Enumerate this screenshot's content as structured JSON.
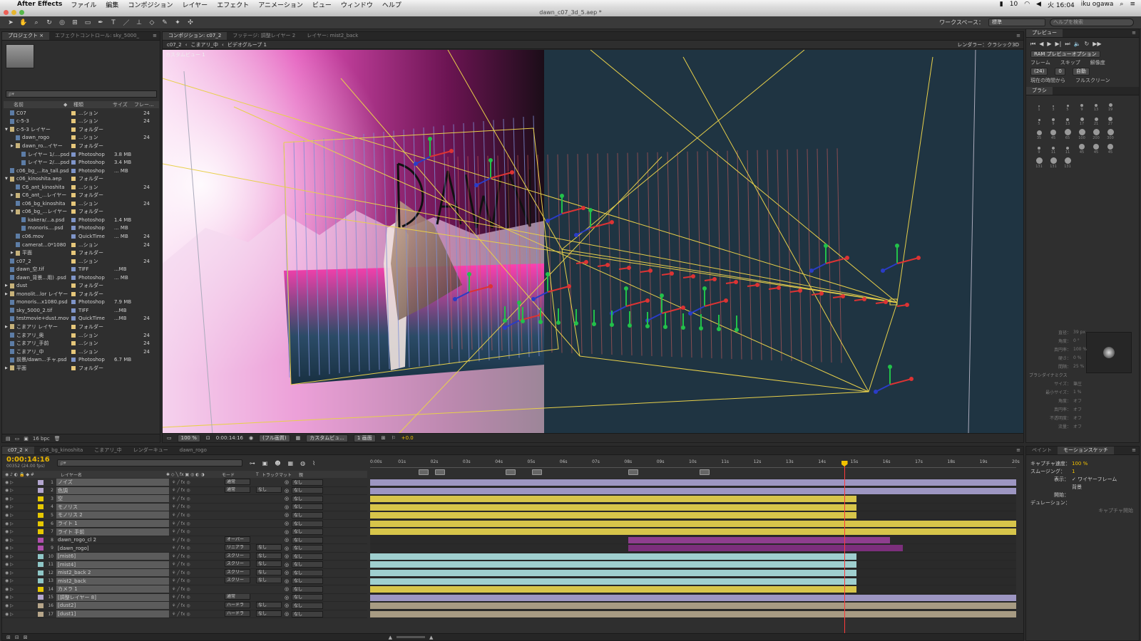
{
  "menubar": {
    "app_name": "After Effects",
    "items": [
      "ファイル",
      "編集",
      "コンポジション",
      "レイヤー",
      "エフェクト",
      "アニメーション",
      "ビュー",
      "ウィンドウ",
      "ヘルプ"
    ],
    "status": {
      "battery": "10",
      "clock": "火 16:04",
      "user": "iku ogawa"
    }
  },
  "window": {
    "title": "dawn_c07_3d_5.aep *"
  },
  "toolbar": {
    "workspace_label": "ワークスペース：",
    "workspace_value": "標準",
    "help_search_placeholder": "ヘルプを検索"
  },
  "project": {
    "tabs": [
      "プロジェクト ×",
      "エフェクトコントロール: sky_5000_"
    ],
    "search_placeholder": "ρ▾",
    "columns": {
      "name": "名前",
      "type": "種類",
      "size": "サイズ",
      "frames": "フレー..."
    },
    "items": [
      {
        "name": "C07",
        "type": "...ション",
        "size": "",
        "fr": "24",
        "label": "#e6c77a",
        "indent": 0,
        "twirl": ""
      },
      {
        "name": "c-5-3",
        "type": "...ション",
        "size": "",
        "fr": "24",
        "label": "#e6c77a",
        "indent": 0,
        "twirl": ""
      },
      {
        "name": "c-5-3 レイヤー",
        "type": "フォルダー",
        "size": "",
        "fr": "",
        "label": "#e6c77a",
        "indent": 0,
        "twirl": "▼"
      },
      {
        "name": "dawn_rogo",
        "type": "...ション",
        "size": "",
        "fr": "24",
        "label": "#e6c77a",
        "indent": 1,
        "twirl": ""
      },
      {
        "name": "dawn_ro...イヤー",
        "type": "フォルダー",
        "size": "",
        "fr": "",
        "label": "#e6c77a",
        "indent": 1,
        "twirl": "▶"
      },
      {
        "name": "レイヤー 1/....psd",
        "type": "Photoshop",
        "size": "3.8 MB",
        "fr": "",
        "label": "#7f95c9",
        "indent": 2,
        "twirl": ""
      },
      {
        "name": "レイヤー 2/....psd",
        "type": "Photoshop",
        "size": "3.4 MB",
        "fr": "",
        "label": "#7f95c9",
        "indent": 2,
        "twirl": ""
      },
      {
        "name": "c06_bg_...ita_tall.psd",
        "type": "Photoshop",
        "size": "... MB",
        "fr": "",
        "label": "#7f95c9",
        "indent": 0,
        "twirl": ""
      },
      {
        "name": "c06_kinoshita.aep",
        "type": "フォルダー",
        "size": "",
        "fr": "",
        "label": "#e6c77a",
        "indent": 0,
        "twirl": "▼"
      },
      {
        "name": "C6_ant_kinoshita",
        "type": "...ション",
        "size": "",
        "fr": "24",
        "label": "#e6c77a",
        "indent": 1,
        "twirl": ""
      },
      {
        "name": "C6_ant_...レイヤー",
        "type": "フォルダー",
        "size": "",
        "fr": "",
        "label": "#e6c77a",
        "indent": 1,
        "twirl": "▶"
      },
      {
        "name": "c06_bg_kinoshita",
        "type": "...ション",
        "size": "",
        "fr": "24",
        "label": "#e6c77a",
        "indent": 1,
        "twirl": ""
      },
      {
        "name": "c06_bg_...レイヤー",
        "type": "フォルダー",
        "size": "",
        "fr": "",
        "label": "#e6c77a",
        "indent": 1,
        "twirl": "▼"
      },
      {
        "name": "kakera/...a.psd",
        "type": "Photoshop",
        "size": "1.4 MB",
        "fr": "",
        "label": "#7f95c9",
        "indent": 2,
        "twirl": ""
      },
      {
        "name": "monoris....psd",
        "type": "Photoshop",
        "size": "... MB",
        "fr": "",
        "label": "#7f95c9",
        "indent": 2,
        "twirl": ""
      },
      {
        "name": "c06.mov",
        "type": "QuickTime",
        "size": "... MB",
        "fr": "24",
        "label": "#7f95c9",
        "indent": 1,
        "twirl": ""
      },
      {
        "name": "camerat...0*1080",
        "type": "...ション",
        "size": "",
        "fr": "24",
        "label": "#e6c77a",
        "indent": 1,
        "twirl": ""
      },
      {
        "name": "平面",
        "type": "フォルダー",
        "size": "",
        "fr": "",
        "label": "#e6c77a",
        "indent": 1,
        "twirl": "▶"
      },
      {
        "name": "c07_2",
        "type": "...ション",
        "size": "",
        "fr": "24",
        "label": "#e6c77a",
        "indent": 0,
        "twirl": ""
      },
      {
        "name": "dawn_空.tif",
        "type": "TIFF",
        "size": "...MB",
        "fr": "",
        "label": "#7f95c9",
        "indent": 0,
        "twirl": ""
      },
      {
        "name": "dawn_背景...用) .psd",
        "type": "Photoshop",
        "size": "... MB",
        "fr": "",
        "label": "#7f95c9",
        "indent": 0,
        "twirl": ""
      },
      {
        "name": "dust",
        "type": "フォルダー",
        "size": "",
        "fr": "",
        "label": "#e6c77a",
        "indent": 0,
        "twirl": "▶"
      },
      {
        "name": "monolit...lor レイヤー",
        "type": "フォルダー",
        "size": "",
        "fr": "",
        "label": "#e6c77a",
        "indent": 0,
        "twirl": "▶"
      },
      {
        "name": "monoris...x1080.psd",
        "type": "Photoshop",
        "size": "7.9 MB",
        "fr": "",
        "label": "#7f95c9",
        "indent": 0,
        "twirl": ""
      },
      {
        "name": "sky_5000_2.tif",
        "type": "TIFF",
        "size": "...MB",
        "fr": "",
        "label": "#7f95c9",
        "indent": 0,
        "twirl": ""
      },
      {
        "name": "testmovie+dust.mov",
        "type": "QuickTime",
        "size": "...MB",
        "fr": "24",
        "label": "#7f95c9",
        "indent": 0,
        "twirl": ""
      },
      {
        "name": "こまアリ レイヤー",
        "type": "フォルダー",
        "size": "",
        "fr": "",
        "label": "#e6c77a",
        "indent": 0,
        "twirl": "▶"
      },
      {
        "name": "こまアリ_奥",
        "type": "...ション",
        "size": "",
        "fr": "24",
        "label": "#e6c77a",
        "indent": 0,
        "twirl": ""
      },
      {
        "name": "こまアリ_手前",
        "type": "...ション",
        "size": "",
        "fr": "24",
        "label": "#e6c77a",
        "indent": 0,
        "twirl": ""
      },
      {
        "name": "こまアリ_中",
        "type": "...ション",
        "size": "",
        "fr": "24",
        "label": "#e6c77a",
        "indent": 0,
        "twirl": ""
      },
      {
        "name": "前景/dawn...チャ.psd",
        "type": "Photoshop",
        "size": "6.7 MB",
        "fr": "",
        "label": "#7f95c9",
        "indent": 0,
        "twirl": ""
      },
      {
        "name": "平面",
        "type": "フォルダー",
        "size": "",
        "fr": "",
        "label": "#e6c77a",
        "indent": 0,
        "twirl": "▶"
      }
    ],
    "footer_bpc": "16 bpc"
  },
  "composition": {
    "tabs": [
      "コンポジション: c07_2",
      "フッテージ: 調整レイヤー 2",
      "レイヤー: mist2_back"
    ],
    "breadcrumbs": [
      "c07_2",
      "こまアリ_中",
      "ビデオグループ 1"
    ],
    "renderer": "レンダラー：クラシック3D",
    "view_label": "カスタムビュー 1",
    "footer": {
      "zoom": "100 %",
      "timecode": "0:00:14:16",
      "resolution": "(フル画質)",
      "view": "カスタムビュ...",
      "views": "1 画面",
      "exposure": "+0.0"
    }
  },
  "preview": {
    "tab": "プレビュー",
    "ram_option": "RAM プレビューオプション",
    "frame_label": "フレーム",
    "skip_label": "スキップ",
    "res_label": "解像度",
    "fps_value": "(24)",
    "skip_value": "0",
    "res_value": "自動",
    "from_current": "現在の時間から",
    "fullscreen": "フルスクリーン",
    "brush_tab": "ブラシ",
    "brush_sizes": [
      "1",
      "3",
      "5",
      "9",
      "13",
      "19",
      "5",
      "9",
      "13",
      "17",
      "21",
      "27",
      "35",
      "45",
      "65",
      "100",
      "200",
      "300",
      "9",
      "11",
      "11",
      "45",
      "45",
      "45",
      "131",
      "131",
      "131"
    ],
    "brush_props": [
      {
        "k": "直径：",
        "v": "39 px"
      },
      {
        "k": "角度：",
        "v": "0 °"
      },
      {
        "k": "真円率：",
        "v": "100 %"
      },
      {
        "k": "硬さ：",
        "v": "0 %"
      },
      {
        "k": "間隔：",
        "v": "25 %"
      }
    ],
    "dynamics_label": "ブラシダイナミクス",
    "dynamics": [
      {
        "k": "サイズ：",
        "v": "筆圧"
      },
      {
        "k": "最小サイズ：",
        "v": "1 %"
      },
      {
        "k": "角度：",
        "v": "オフ"
      },
      {
        "k": "真円率：",
        "v": "オフ"
      },
      {
        "k": "不透明度：",
        "v": "オフ"
      },
      {
        "k": "流量：",
        "v": "オフ"
      }
    ]
  },
  "timeline": {
    "tabs": [
      "c07_2 ×",
      "c06_bg_kinoshita",
      "こまアリ_中",
      "レンダーキュー",
      "dawn_rogo"
    ],
    "timecode": "0:00:14:16",
    "timecode_sub": "00352 (24.00 fps)",
    "search_placeholder": "ρ▾",
    "columns": {
      "name": "レイヤー名",
      "mode": "モード",
      "t": "T",
      "trkmat": "トラックマット",
      "parent": "親"
    },
    "ruler": [
      "0:00s",
      "01s",
      "02s",
      "03s",
      "04s",
      "05s",
      "06s",
      "07s",
      "08s",
      "09s",
      "10s",
      "11s",
      "12s",
      "13s",
      "14s",
      "15s",
      "16s",
      "17s",
      "18s",
      "19s",
      "20s"
    ],
    "duration_seconds": 20,
    "current_time_seconds": 14.67,
    "markers_seconds": [
      1.5,
      2.0,
      4.2,
      5.0,
      8.0,
      10.2
    ],
    "layers": [
      {
        "n": "1",
        "name": "ノイズ",
        "color": "#b3a6cf",
        "mode": "通常",
        "trk": "",
        "parent": "なし",
        "bar": {
          "start": 0,
          "end": 20,
          "color": "#9d96c2"
        }
      },
      {
        "n": "2",
        "name": "色調",
        "color": "#b3a6cf",
        "mode": "通常",
        "trk": "なし",
        "parent": "なし",
        "bar": {
          "start": 0,
          "end": 20,
          "color": "#9d96c2"
        }
      },
      {
        "n": "3",
        "name": "空",
        "color": "#e6c800",
        "mode": "",
        "trk": "",
        "parent": "なし",
        "bar": {
          "start": 0,
          "end": 15.05,
          "color": "#d7c54a"
        }
      },
      {
        "n": "4",
        "name": "モノリス",
        "color": "#e6c800",
        "mode": "",
        "trk": "",
        "parent": "なし",
        "bar": {
          "start": 0,
          "end": 15.05,
          "color": "#d7c54a"
        }
      },
      {
        "n": "5",
        "name": "モノリス 2",
        "color": "#e6c800",
        "mode": "",
        "trk": "",
        "parent": "なし",
        "bar": {
          "start": 0,
          "end": 15.05,
          "color": "#d7c54a"
        }
      },
      {
        "n": "6",
        "name": "ライト 1",
        "color": "#e6c800",
        "mode": "",
        "trk": "",
        "parent": "なし",
        "bar": {
          "start": 0,
          "end": 20,
          "color": "#d7c54a"
        }
      },
      {
        "n": "7",
        "name": "ライト 手前",
        "color": "#e6c800",
        "mode": "",
        "trk": "",
        "parent": "なし",
        "bar": {
          "start": 0,
          "end": 20,
          "color": "#d7c54a"
        }
      },
      {
        "n": "8",
        "name": "dawn_rogo_cl 2",
        "color": "#b04fae",
        "mode": "オーバー",
        "trk": "",
        "parent": "なし",
        "bar": {
          "start": 8.0,
          "end": 16.1,
          "color": "#8e3e8e"
        }
      },
      {
        "n": "9",
        "name": "[dawn_rogo]",
        "color": "#b04fae",
        "mode": "リニアラ",
        "trk": "なし",
        "parent": "なし",
        "bar": {
          "start": 8.0,
          "end": 16.5,
          "color": "#7c2f7c"
        }
      },
      {
        "n": "10",
        "name": "[mist6]",
        "color": "#8fc7c7",
        "mode": "スクリー",
        "trk": "なし",
        "parent": "なし",
        "bar": {
          "start": 0,
          "end": 15.05,
          "color": "#9fcfcf"
        }
      },
      {
        "n": "11",
        "name": "[mist4]",
        "color": "#8fc7c7",
        "mode": "スクリー",
        "trk": "なし",
        "parent": "なし",
        "bar": {
          "start": 0,
          "end": 15.05,
          "color": "#9fcfcf"
        }
      },
      {
        "n": "12",
        "name": "mist2_back 2",
        "color": "#8fc7c7",
        "mode": "スクリー",
        "trk": "なし",
        "parent": "なし",
        "bar": {
          "start": 0,
          "end": 15.05,
          "color": "#9fcfcf"
        }
      },
      {
        "n": "13",
        "name": "mist2_back",
        "color": "#8fc7c7",
        "mode": "スクリー",
        "trk": "なし",
        "parent": "なし",
        "bar": {
          "start": 0,
          "end": 15.05,
          "color": "#9fcfcf"
        }
      },
      {
        "n": "14",
        "name": "カメラ 1",
        "color": "#e6c800",
        "mode": "",
        "trk": "",
        "parent": "なし",
        "bar": {
          "start": 0,
          "end": 15.05,
          "color": "#d7c54a"
        }
      },
      {
        "n": "15",
        "name": "[調整レイヤー 8]",
        "color": "#b3a6cf",
        "mode": "通常",
        "trk": "",
        "parent": "なし",
        "bar": {
          "start": 0,
          "end": 20,
          "color": "#9d96c2"
        }
      },
      {
        "n": "16",
        "name": "[dust2]",
        "color": "#b7a68a",
        "mode": "ハードラ",
        "trk": "なし",
        "parent": "なし",
        "bar": {
          "start": 0,
          "end": 20,
          "color": "#a79b83"
        }
      },
      {
        "n": "17",
        "name": "[dust1]",
        "color": "#b7a68a",
        "mode": "ハードラ",
        "trk": "なし",
        "parent": "なし",
        "bar": {
          "start": 0,
          "end": 20,
          "color": "#a79b83"
        }
      }
    ]
  },
  "motion_sketch": {
    "tabs": [
      "ペイント",
      "モーションスケッチ"
    ],
    "capture_speed_label": "キャプチャ速度：",
    "capture_speed_value": "100 %",
    "smoothing_label": "スムージング：",
    "smoothing_value": "1",
    "show_label": "表示：",
    "wireframe": "✓ ワイヤーフレーム",
    "background": "背景",
    "start_label": "開始：",
    "duration_label": "デュレーション：",
    "capture_button": "キャプチャ開始"
  },
  "colors": {
    "accent": "#f2c100",
    "cti": "#ff3b3b",
    "panel": "#2f2f2f"
  }
}
